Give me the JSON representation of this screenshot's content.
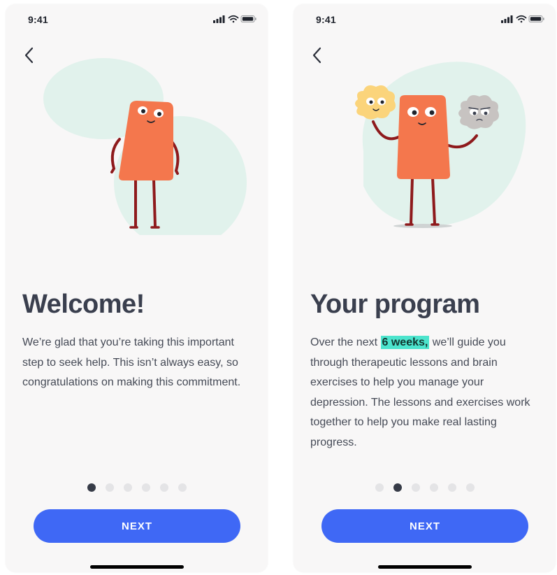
{
  "colors": {
    "primary_button": "#3f68f5",
    "highlight": "#4ce4cd",
    "blob": "#e1f2ec",
    "character_body": "#f4774d",
    "character_limbs": "#8e1a1c",
    "active_dot": "#363b47",
    "inactive_dot": "#e4e4e6",
    "title_text": "#3a3f4e",
    "body_text": "#454a56"
  },
  "screens": [
    {
      "status": {
        "time": "9:41",
        "icons": [
          "signal-icon",
          "wifi-icon",
          "battery-icon"
        ]
      },
      "back_icon": "chevron-left-icon",
      "title": "Welcome!",
      "body": "We’re glad that you’re taking this important step to seek help. This isn’t always easy, so congratulations on making this commitment.",
      "pagination": {
        "count": 6,
        "active": 1
      },
      "next_label": "NEXT"
    },
    {
      "status": {
        "time": "9:41",
        "icons": [
          "signal-icon",
          "wifi-icon",
          "battery-icon"
        ]
      },
      "back_icon": "chevron-left-icon",
      "title": "Your program",
      "body_before": "Over the next ",
      "body_highlight": "6 weeks,",
      "body_after": " we’ll guide you through therapeutic lessons and brain exercises to help you manage your depression. The lessons and exercises work together to help you make real lasting progress.",
      "pagination": {
        "count": 6,
        "active": 2
      },
      "next_label": "NEXT"
    }
  ]
}
